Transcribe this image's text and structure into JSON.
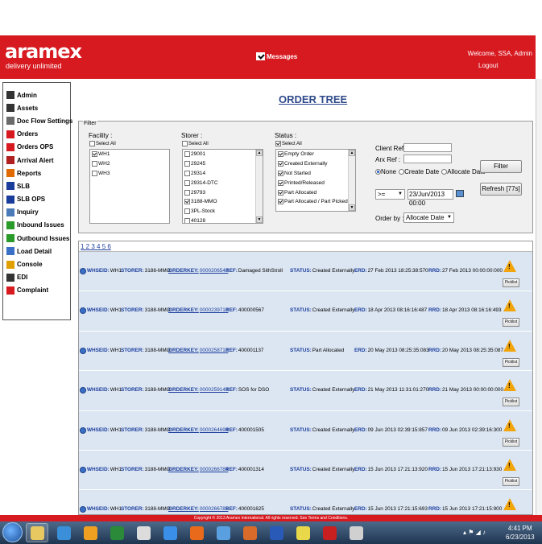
{
  "header": {
    "logo": "aramex",
    "tagline": "delivery unlimited",
    "messages_label": "Messages",
    "welcome": "Welcome, SSA, Admin",
    "logout": "Logout"
  },
  "sidebar": {
    "items": [
      {
        "label": "Admin",
        "icon": "gear-icon",
        "color": "#333333"
      },
      {
        "label": "Assets",
        "icon": "cube-icon",
        "color": "#333333"
      },
      {
        "label": "Doc Flow Settings",
        "icon": "flow-icon",
        "color": "#6a6a6a"
      },
      {
        "label": "Orders",
        "icon": "orders-icon",
        "color": "#d71920"
      },
      {
        "label": "Orders OPS",
        "icon": "orders-ops-icon",
        "color": "#d71920"
      },
      {
        "label": "Arrival Alert",
        "icon": "alert-icon",
        "color": "#b02020"
      },
      {
        "label": "Reports",
        "icon": "reports-icon",
        "color": "#e06a00"
      },
      {
        "label": "SLB",
        "icon": "slb-icon",
        "color": "#1a3d9c"
      },
      {
        "label": "SLB OPS",
        "icon": "slb-ops-icon",
        "color": "#1a3d9c"
      },
      {
        "label": "Inquiry",
        "icon": "magnifier-icon",
        "color": "#4a7ab8"
      },
      {
        "label": "Inbound Issues",
        "icon": "inbound-icon",
        "color": "#2a9a2a"
      },
      {
        "label": "Outbound Issues",
        "icon": "outbound-icon",
        "color": "#2a9a2a"
      },
      {
        "label": "Load Detail",
        "icon": "load-icon",
        "color": "#3a6fc8"
      },
      {
        "label": "Console",
        "icon": "console-icon",
        "color": "#e0a000"
      },
      {
        "label": "EDI",
        "icon": "edi-icon",
        "color": "#333333"
      },
      {
        "label": "Complaint",
        "icon": "complaint-icon",
        "color": "#d71920"
      }
    ]
  },
  "page": {
    "title": "ORDER TREE"
  },
  "filter": {
    "legend": "Filter",
    "facility": {
      "label": "Facility :",
      "select_all": "Select All",
      "options": [
        {
          "label": "WH1",
          "checked": true
        },
        {
          "label": "WH2",
          "checked": false
        },
        {
          "label": "WH3",
          "checked": false
        }
      ]
    },
    "storer": {
      "label": "Storer :",
      "select_all": "Select All",
      "options": [
        {
          "label": "29001",
          "checked": false
        },
        {
          "label": "29245",
          "checked": false
        },
        {
          "label": "29314",
          "checked": false
        },
        {
          "label": "29314-DTC",
          "checked": false
        },
        {
          "label": "29793",
          "checked": false
        },
        {
          "label": "3188-MMO",
          "checked": true
        },
        {
          "label": "3PL-Stock",
          "checked": false
        },
        {
          "label": "40128",
          "checked": false
        }
      ]
    },
    "status": {
      "label": "Status :",
      "select_all": "Select All",
      "options": [
        {
          "label": "Empty Order",
          "checked": true
        },
        {
          "label": "Created Externally",
          "checked": true
        },
        {
          "label": "Not Started",
          "checked": true
        },
        {
          "label": "Printed/Released",
          "checked": true
        },
        {
          "label": "Part Allocated",
          "checked": true
        },
        {
          "label": "Part Allocated / Part Picked",
          "checked": true
        }
      ]
    },
    "client_ref_label": "Client Ref :",
    "arx_ref_label": "Arx Ref :",
    "radio": [
      {
        "label": "None",
        "checked": true
      },
      {
        "label": "Create Date",
        "checked": false
      },
      {
        "label": "Allocate Date",
        "checked": false
      }
    ],
    "filter_button": "Filter",
    "refresh_button": "Refresh [77s]",
    "operator": ">=",
    "date_value": "23/Jun/2013 00:00",
    "order_by_label": "Order by :",
    "order_by_value": "Allocate Date"
  },
  "results": {
    "pager": "1 2 3 4 5 6",
    "labels": {
      "whseid": "WHSEID:",
      "storer": "STORER:",
      "orderkey": "ORDERKEY:",
      "ref": "REF:",
      "status": "STATUS:",
      "erd": "ERD:",
      "rrd": "RRD:",
      "picklist": "Picklist"
    },
    "rows": [
      {
        "whseid": "WH1",
        "storer": "3188-MMO",
        "orderkey": "0000206548",
        "ref": "Damaged SithStroll",
        "status": "Created Externally",
        "erd": "27 Feb 2013 18:25:38:570",
        "rrd": "27 Feb 2013 00:00:00:000"
      },
      {
        "whseid": "WH1",
        "storer": "3188-MMO",
        "orderkey": "0000239718",
        "ref": "400000567",
        "status": "Created Externally",
        "erd": "18 Apr 2013 08:16:16:487",
        "rrd": "18 Apr 2013 08:16:16:493"
      },
      {
        "whseid": "WH1",
        "storer": "3188-MMO",
        "orderkey": "0000258718",
        "ref": "400001137",
        "status": "Part Allocated",
        "erd": "20 May 2013 08:25:35:083",
        "rrd": "20 May 2013 08:25:35:087"
      },
      {
        "whseid": "WH1",
        "storer": "3188-MMO",
        "orderkey": "0000259143",
        "ref": "SOS for DSO",
        "status": "Created Externally",
        "erd": "21 May 2013 11:31:01:270",
        "rrd": "21 May 2013 00:00:00:000"
      },
      {
        "whseid": "WH1",
        "storer": "3188-MMO",
        "orderkey": "0000264694",
        "ref": "400001505",
        "status": "Created Externally",
        "erd": "09 Jun 2013 02:39:15:857",
        "rrd": "09 Jun 2013 02:39:16:300"
      },
      {
        "whseid": "WH1",
        "storer": "3188-MMO",
        "orderkey": "0000266784",
        "ref": "400001314",
        "status": "Created Externally",
        "erd": "15 Jun 2013 17:21:13:920",
        "rrd": "15 Jun 2013 17:21:13:930"
      },
      {
        "whseid": "WH1",
        "storer": "3188-MMO",
        "orderkey": "0000266785",
        "ref": "400001625",
        "status": "Created Externally",
        "erd": "15 Jun 2013 17:21:15:693",
        "rrd": "15 Jun 2013 17:21:15:900"
      }
    ]
  },
  "footer": {
    "text": "Copyright © 2013 Aramex International. All rights reserved. See Terms and Conditions."
  },
  "taskbar": {
    "apps": [
      {
        "icon": "explorer-icon",
        "color": "#e8c860"
      },
      {
        "icon": "lync-icon",
        "color": "#3a8fd8"
      },
      {
        "icon": "outlook-icon",
        "color": "#f0a020"
      },
      {
        "icon": "excel-icon",
        "color": "#2a8a3a"
      },
      {
        "icon": "viewer-icon",
        "color": "#dcdcdc"
      },
      {
        "icon": "ie-icon",
        "color": "#3a8fe8"
      },
      {
        "icon": "firefox-icon",
        "color": "#e86a1a"
      },
      {
        "icon": "window-icon",
        "color": "#5aa0e0"
      },
      {
        "icon": "paint-icon",
        "color": "#d86a2a"
      },
      {
        "icon": "word-icon",
        "color": "#2a5ab8"
      },
      {
        "icon": "notes-icon",
        "color": "#e8d84a"
      },
      {
        "icon": "acrobat-icon",
        "color": "#c82020"
      },
      {
        "icon": "settings-icon",
        "color": "#d0d0d0"
      }
    ],
    "time": "4:41 PM",
    "date": "6/23/2013"
  }
}
